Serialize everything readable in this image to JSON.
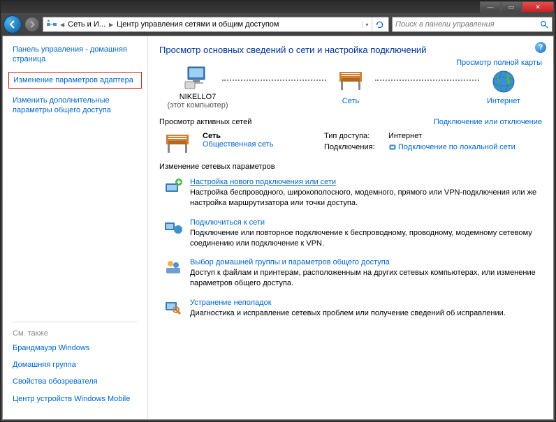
{
  "titlebar": {
    "min": "—",
    "max": "▭",
    "close": "✕"
  },
  "nav": {
    "addr_seg1": "Сеть и И...",
    "addr_seg2": "Центр управления сетями и общим доступом",
    "search_placeholder": "Поиск в панели управления"
  },
  "sidebar": {
    "home": "Панель управления - домашняя страница",
    "adapter": "Изменение параметров адаптера",
    "sharing": "Изменить дополнительные параметры общего доступа",
    "seealso_hdr": "См. также",
    "firewall": "Брандмауэр Windows",
    "homegroup": "Домашняя группа",
    "browser": "Свойства обозревателя",
    "winmobile": "Центр устройств Windows Mobile"
  },
  "main": {
    "title": "Просмотр основных сведений о сети и настройка подключений",
    "fullmap": "Просмотр полной карты",
    "node1_name": "NIKELLO7",
    "node1_sub": "(этот компьютер)",
    "node2_name": "Сеть",
    "node3_name": "Интернет",
    "active_hdr": "Просмотр активных сетей",
    "active_rlink": "Подключение или отключение",
    "an_name": "Сеть",
    "an_type": "Общественная сеть",
    "an_access_lbl": "Тип доступа:",
    "an_access_val": "Интернет",
    "an_conn_lbl": "Подключения:",
    "an_conn_val": "Подключение по локальной сети",
    "change_hdr": "Изменение сетевых параметров",
    "task1_link": "Настройка нового подключения или сети",
    "task1_desc": "Настройка беспроводного, широкополосного, модемного, прямого или VPN-подключения или же настройка маршрутизатора или точки доступа.",
    "task2_link": "Подключиться к сети",
    "task2_desc": "Подключение или повторное подключение к беспроводному, проводному, модемному сетевому соединению или подключение к VPN.",
    "task3_link": "Выбор домашней группы и параметров общего доступа",
    "task3_desc": "Доступ к файлам и принтерам, расположенным на других сетевых компьютерах, или изменение параметров общего доступа.",
    "task4_link": "Устранение неполадок",
    "task4_desc": "Диагностика и исправление сетевых проблем или получение сведений об исправлении."
  }
}
